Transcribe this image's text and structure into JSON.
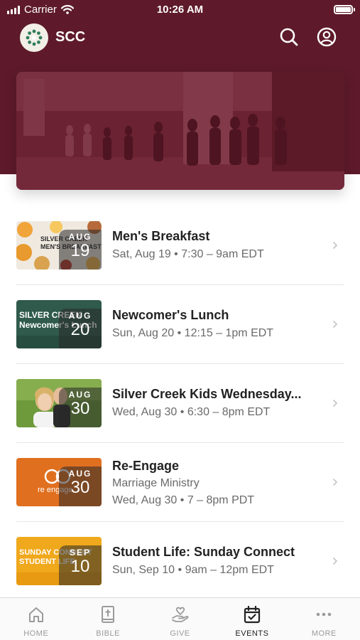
{
  "status_bar": {
    "carrier": "Carrier",
    "time": "10:26 AM"
  },
  "header": {
    "title": "SCC"
  },
  "events": [
    {
      "title": "Men's Breakfast",
      "month": "AUG",
      "day": "19",
      "lines": [
        "Sat, Aug 19 • 7:30 – 9am EDT"
      ],
      "thumb_text": "SILVER CREEK MEN'S BREAKFAST"
    },
    {
      "title": "Newcomer's Lunch",
      "month": "AUG",
      "day": "20",
      "lines": [
        "Sun, Aug 20 • 12:15 – 1pm EDT"
      ],
      "thumb_text": "SILVER CREEK Newcomer's Lunch"
    },
    {
      "title": "Silver Creek Kids Wednesday...",
      "month": "AUG",
      "day": "30",
      "lines": [
        "Wed, Aug 30 • 6:30 – 8pm EDT"
      ],
      "thumb_text": ""
    },
    {
      "title": "Re-Engage",
      "month": "AUG",
      "day": "30",
      "lines": [
        "Marriage Ministry",
        "Wed, Aug 30 • 7 – 8pm PDT"
      ],
      "thumb_text": "re engage"
    },
    {
      "title": "Student Life: Sunday Connect",
      "month": "SEP",
      "day": "10",
      "lines": [
        "Sun, Sep 10 • 9am – 12pm EDT"
      ],
      "thumb_text": "SUNDAY CONNECT STUDENT LIFE"
    }
  ],
  "tabs": [
    {
      "label": "HOME",
      "icon": "home-icon",
      "active": false
    },
    {
      "label": "BIBLE",
      "icon": "bible-icon",
      "active": false
    },
    {
      "label": "GIVE",
      "icon": "give-icon",
      "active": false
    },
    {
      "label": "EVENTS",
      "icon": "calendar-icon",
      "active": true
    },
    {
      "label": "MORE",
      "icon": "more-icon",
      "active": false
    }
  ],
  "colors": {
    "brand": "#5e1a2a",
    "text": "#222222",
    "muted": "#6a6a6a"
  }
}
